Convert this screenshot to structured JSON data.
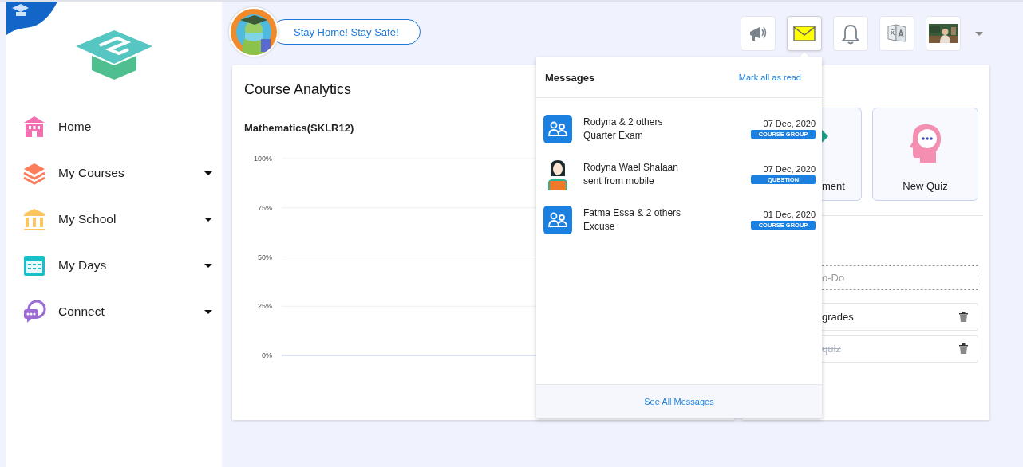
{
  "sidebar": {
    "items": [
      {
        "label": "Home",
        "kind": "home",
        "expandable": false
      },
      {
        "label": "My Courses",
        "kind": "books",
        "expandable": true
      },
      {
        "label": "My School",
        "kind": "school",
        "expandable": true
      },
      {
        "label": "My Days",
        "kind": "calendar",
        "expandable": true
      },
      {
        "label": "Connect",
        "kind": "chat",
        "expandable": true
      }
    ]
  },
  "banner": {
    "text": "Stay Home! Stay Safe!"
  },
  "toolbar": {
    "buttons": [
      {
        "kind": "announcements",
        "selected": false
      },
      {
        "kind": "messages",
        "selected": true
      },
      {
        "kind": "notifications",
        "selected": false
      },
      {
        "kind": "language",
        "selected": false
      },
      {
        "kind": "profile",
        "selected": false
      }
    ]
  },
  "analytics": {
    "title": "Course Analytics",
    "course": "Mathematics(SKLR12)",
    "axis_labels": [
      "100%",
      "75%",
      "50%",
      "25%",
      "0%"
    ]
  },
  "quick_actions": [
    {
      "label": "ment",
      "kind": "assignment"
    },
    {
      "label": "New Quiz",
      "kind": "quiz"
    }
  ],
  "todo": {
    "placeholder": "o-Do",
    "items": [
      {
        "text": "grades",
        "done": false
      },
      {
        "text": "quiz",
        "done": true
      }
    ]
  },
  "messages": {
    "title": "Messages",
    "mark_all": "Mark all as read",
    "items": [
      {
        "kind": "group",
        "sender": "Rodyna & 2 others",
        "subject": "Quarter Exam",
        "date": "07 Dec, 2020",
        "tag": "COURSE GROUP"
      },
      {
        "kind": "person",
        "sender": "Rodyna Wael Shalaan",
        "subject": "sent from mobile",
        "date": "07 Dec, 2020",
        "tag": "QUESTION"
      },
      {
        "kind": "group",
        "sender": "Fatma Essa & 2 others",
        "subject": "Excuse",
        "date": "01 Dec, 2020",
        "tag": "COURSE GROUP"
      }
    ],
    "footer": "See All Messages"
  }
}
